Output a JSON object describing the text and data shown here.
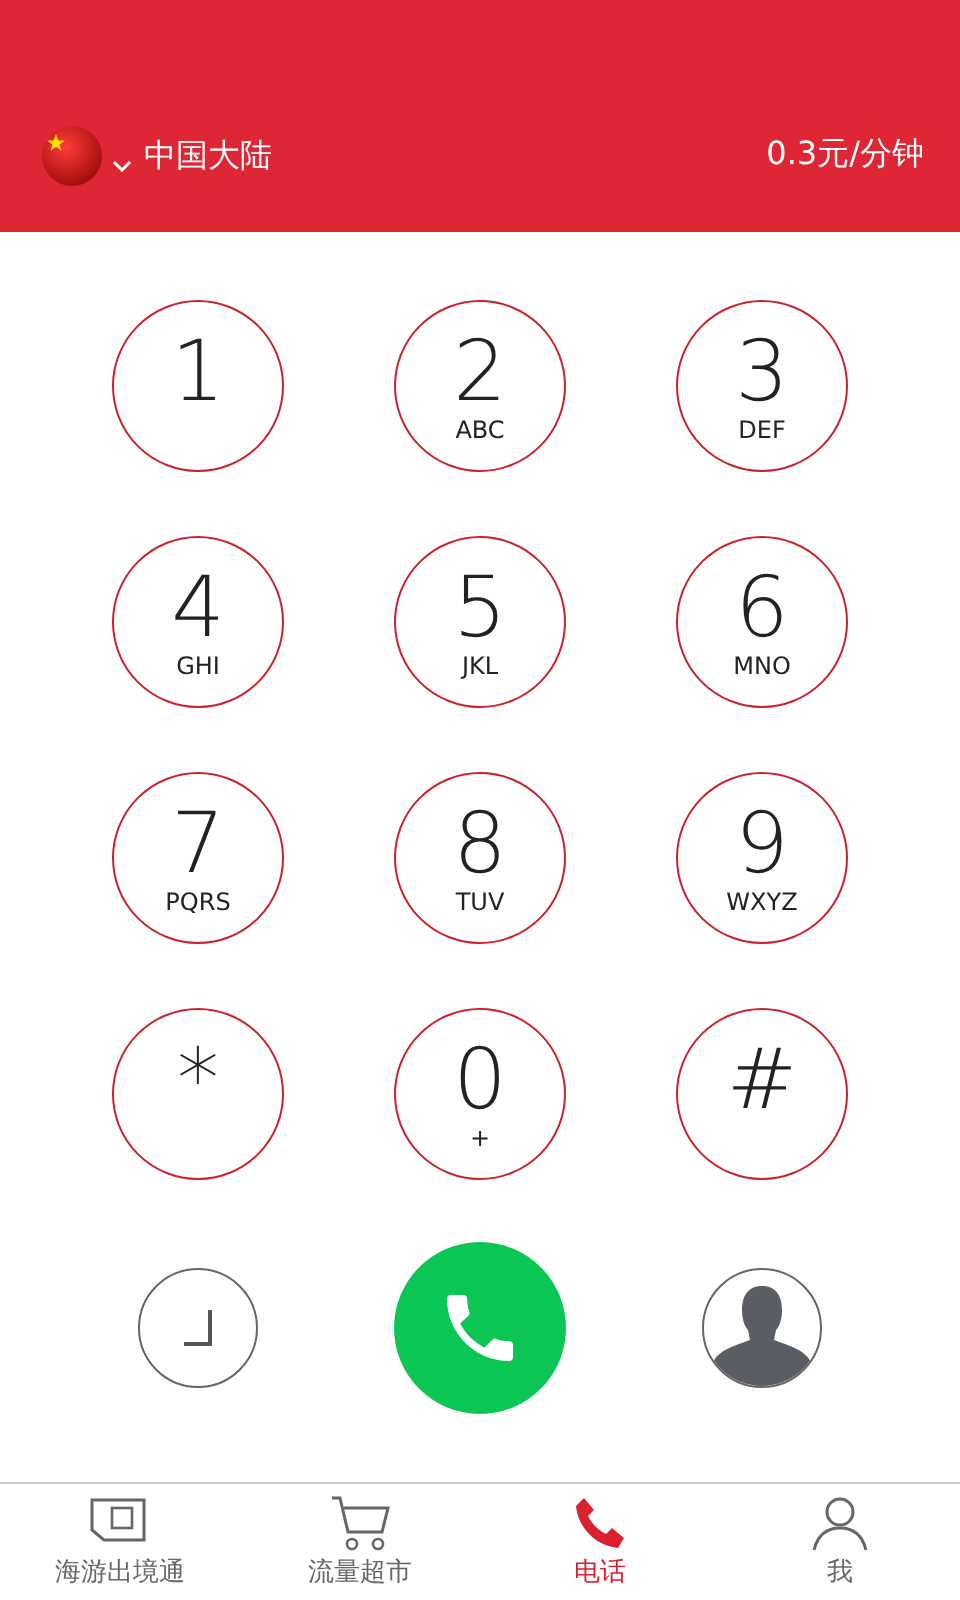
{
  "header": {
    "region": "中国大陆",
    "rate": "0.3元/分钟"
  },
  "keys": [
    {
      "digit": "1"
    },
    {
      "digit": "2",
      "letters": "ABC"
    },
    {
      "digit": "3",
      "letters": "DEF"
    },
    {
      "digit": "4",
      "letters": "GHI"
    },
    {
      "digit": "5",
      "letters": "JKL"
    },
    {
      "digit": "6",
      "letters": "MNO"
    },
    {
      "digit": "7",
      "letters": "PQRS"
    },
    {
      "digit": "8",
      "letters": "TUV"
    },
    {
      "digit": "9",
      "letters": "WXYZ"
    },
    {
      "digit": "*"
    },
    {
      "digit": "0",
      "letters": "+"
    },
    {
      "digit": "#"
    }
  ],
  "tabs": [
    {
      "kind": "sim",
      "label": "海游出境通",
      "selected": false
    },
    {
      "kind": "cart",
      "label": "流量超市",
      "selected": false
    },
    {
      "kind": "phone",
      "label": "电话",
      "selected": true
    },
    {
      "kind": "person",
      "label": "我",
      "selected": false
    }
  ]
}
